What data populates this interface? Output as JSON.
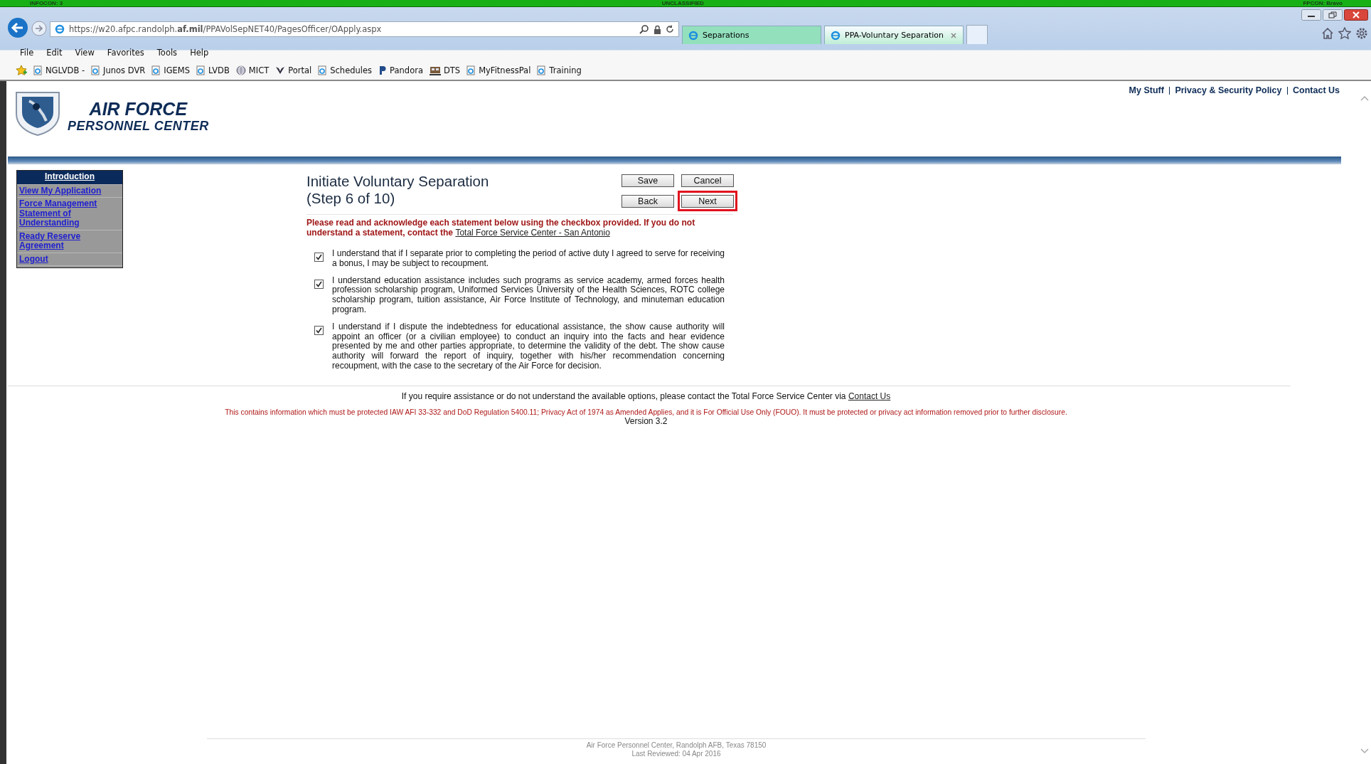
{
  "banner": {
    "left": "INFOCON: 3",
    "center": "UNCLASSIFIED",
    "right": "FPCON: Bravo"
  },
  "browser": {
    "url": "https://w20.afpc.randolph.**af.mil**/PPAVolSepNET40/PagesOfficer/OApply.aspx",
    "tabs": [
      {
        "label": "Separations",
        "selected": false
      },
      {
        "label": "PPA-Voluntary Separation",
        "selected": true
      }
    ],
    "menu": [
      "File",
      "Edit",
      "View",
      "Favorites",
      "Tools",
      "Help"
    ],
    "favorites": [
      {
        "label": "NGLVDB -",
        "kind": "page"
      },
      {
        "label": "Junos DVR",
        "kind": "page"
      },
      {
        "label": "IGEMS",
        "kind": "page"
      },
      {
        "label": "LVDB",
        "kind": "page"
      },
      {
        "label": "MICT",
        "kind": "globe"
      },
      {
        "label": "Portal",
        "kind": "wings"
      },
      {
        "label": "Schedules",
        "kind": "page"
      },
      {
        "label": "Pandora",
        "kind": "letter"
      },
      {
        "label": "DTS",
        "kind": "train"
      },
      {
        "label": "MyFitnessPal",
        "kind": "page"
      },
      {
        "label": "Training",
        "kind": "page"
      }
    ]
  },
  "site": {
    "links": [
      "My Stuff",
      "Privacy & Security Policy",
      "Contact Us"
    ],
    "title": "AIR FORCE",
    "subtitle": "PERSONNEL CENTER"
  },
  "sidebar": {
    "items": [
      {
        "label": "Introduction",
        "selected": true
      },
      {
        "label": "View My Application",
        "selected": false
      },
      {
        "label": "Force Management Statement of Understanding",
        "selected": false
      },
      {
        "label": "Ready Reserve Agreement",
        "selected": false
      },
      {
        "label": "Logout",
        "selected": false
      }
    ]
  },
  "form": {
    "title": "Initiate Voluntary Separation",
    "step": "(Step 6 of 10)",
    "buttons": [
      {
        "label": "Save",
        "highlighted": false
      },
      {
        "label": "Cancel",
        "highlighted": false
      },
      {
        "label": "Back",
        "highlighted": false
      },
      {
        "label": "Next",
        "highlighted": true
      }
    ],
    "instructions": "Please read and acknowledge each statement below using the checkbox provided. If you do not understand a statement, contact the",
    "instructions_link": "Total Force Service Center - San Antonio",
    "statements": [
      {
        "text": "I understand that if I separate prior to completing the period of active duty I agreed to serve for receiving a bonus, I may be subject to recoupment.",
        "checked": true
      },
      {
        "text": "I understand education assistance includes such programs as service academy, armed forces health profession scholarship program, Uniformed Services University of the Health Sciences, ROTC college scholarship program, tuition assistance, Air Force Institute of Technology, and minuteman education program.",
        "checked": true
      },
      {
        "text": "I understand if I dispute the indebtedness for educational assistance, the show cause authority will appoint an officer (or a civilian employee) to conduct an inquiry into the facts and hear evidence presented by me and other parties appropriate, to determine the validity of the debt. The show cause authority will forward the report of inquiry, together with his/her recommendation concerning recoupment, with the case to the secretary of the Air Force for decision.",
        "checked": true
      }
    ]
  },
  "footer": {
    "assist": "If you require assistance or do not understand the available options, please contact the Total Force Service Center via",
    "assist_link": "Contact Us",
    "notice": "This contains information which must be protected IAW AFI 33-332 and DoD Regulation 5400.11; Privacy Act of 1974 as Amended Applies, and it is For Official Use Only (FOUO). It must be protected or privacy act information removed prior to further disclosure.",
    "version": "Version 3.2"
  },
  "page_footer": {
    "address": "Air Force Personnel Center, Randolph AFB, Texas 78150",
    "reviewed": "Last Reviewed: 04 Apr 2016"
  }
}
